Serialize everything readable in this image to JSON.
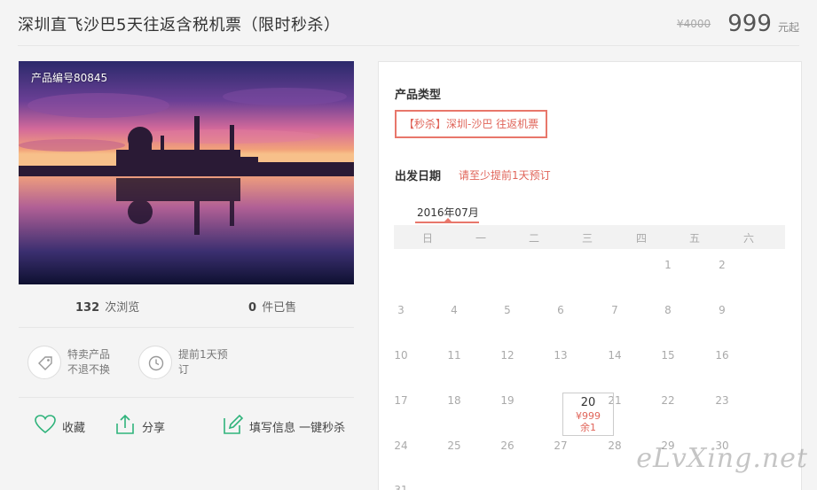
{
  "product": {
    "title": "深圳直飞沙巴5天往返含税机票（限时秒杀）",
    "old_price": "¥4000",
    "price": "999",
    "price_unit": "元起",
    "code_label": "产品编号80845"
  },
  "stats": {
    "views_count": "132",
    "views_label": "次浏览",
    "sold_count": "0",
    "sold_label": "件已售"
  },
  "features": [
    {
      "line1": "特卖产品",
      "line2": "不退不换",
      "icon": "tag-icon"
    },
    {
      "line1": "提前1天预",
      "line2": "订",
      "icon": "clock-icon"
    }
  ],
  "actions": {
    "favorite": "收藏",
    "share": "分享",
    "fill_info": "填写信息 一键秒杀"
  },
  "booking": {
    "type_heading": "产品类型",
    "type_option": "【秒杀】深圳-沙巴 往返机票",
    "date_heading": "出发日期",
    "date_hint": "请至少提前1天预订",
    "month": "2016年07月",
    "weekdays": [
      "日",
      "一",
      "二",
      "三",
      "四",
      "五",
      "六"
    ],
    "selected_day": {
      "day": "20",
      "price": "¥999",
      "stock": "余1"
    }
  },
  "calendar": {
    "rows": [
      [
        "",
        "",
        "",
        "",
        "",
        "1",
        "2"
      ],
      [
        "3",
        "4",
        "5",
        "6",
        "7",
        "8",
        "9"
      ],
      [
        "10",
        "11",
        "12",
        "13",
        "14",
        "15",
        "16"
      ],
      [
        "17",
        "18",
        "19",
        "",
        "21",
        "22",
        "23"
      ],
      [
        "24",
        "25",
        "26",
        "27",
        "28",
        "29",
        "30"
      ],
      [
        "31",
        "",
        "",
        "",
        "",
        "",
        ""
      ]
    ]
  },
  "watermark": "eLvXing.net",
  "colors": {
    "accent": "#e0655a",
    "icon_green": "#2fb37b"
  }
}
